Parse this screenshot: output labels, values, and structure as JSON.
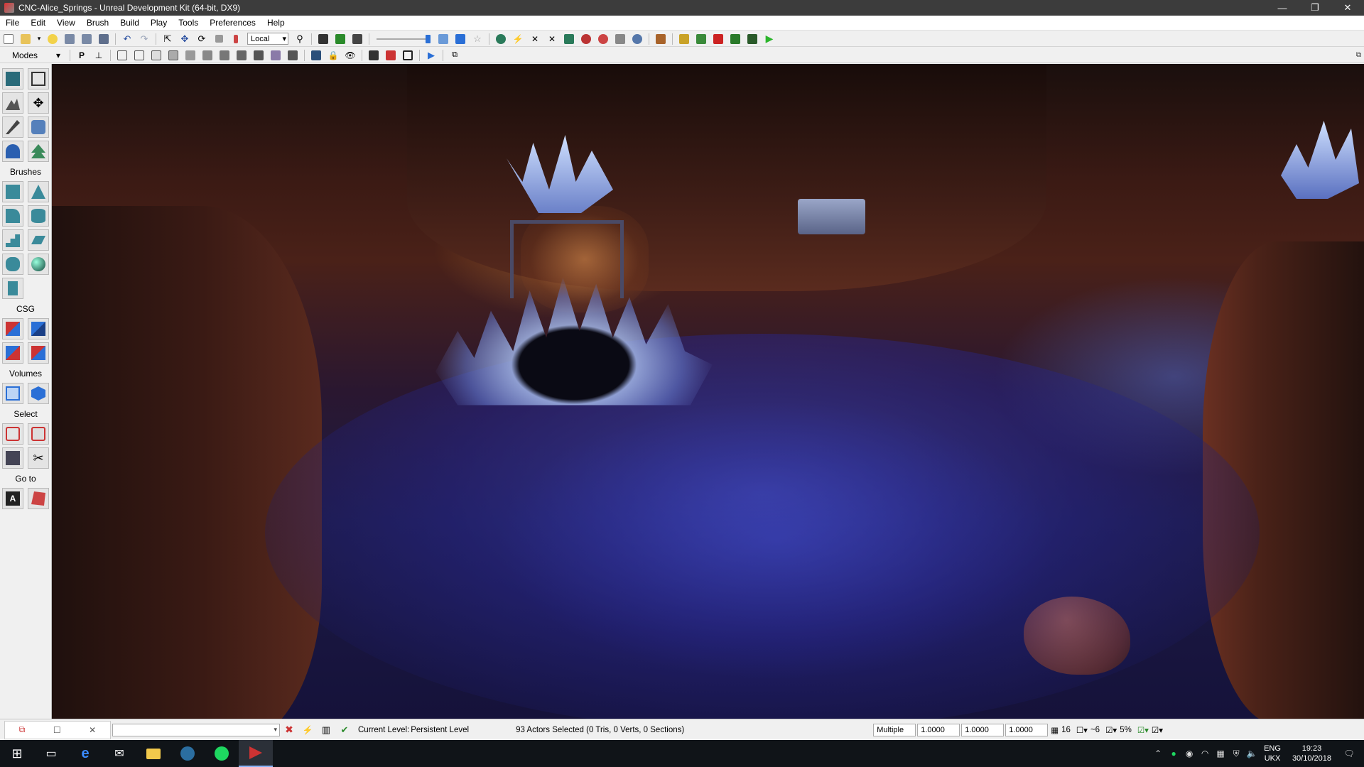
{
  "window": {
    "title": "CNC-Alice_Springs - Unreal Development Kit (64-bit, DX9)",
    "minimize": "—",
    "maximize": "❐",
    "close": "✕"
  },
  "menu": [
    "File",
    "Edit",
    "View",
    "Brush",
    "Build",
    "Play",
    "Tools",
    "Preferences",
    "Help"
  ],
  "toolbar1": {
    "coord_system": "Local",
    "coord_arrow": "▾"
  },
  "toolbar2": {
    "modes_label": "Modes",
    "modes_arrow": "▾",
    "p_label": "P"
  },
  "panel": {
    "brushes_label": "Brushes",
    "csg_label": "CSG",
    "volumes_label": "Volumes",
    "select_label": "Select",
    "goto_label": "Go to"
  },
  "statusbar": {
    "current_level_label": "Current Level:",
    "current_level_value": "Persistent Level",
    "selection_info": "93 Actors Selected (0 Tris, 0 Verts, 0 Sections)",
    "drag_mode": "Multiple",
    "scale_x": "1.0000",
    "scale_y": "1.0000",
    "scale_z": "1.0000",
    "grid_size": "16",
    "rotation_snap": "~6",
    "scale_snap": "5%"
  },
  "taskbar": {
    "lang_top": "ENG",
    "lang_bottom": "UKX",
    "time": "19:23",
    "date": "30/10/2018"
  },
  "colors": {
    "titlebar": "#3c3c3c",
    "taskbar": "#101418",
    "accent_blue": "#2a6fd6",
    "play_green": "#2bb52b"
  }
}
